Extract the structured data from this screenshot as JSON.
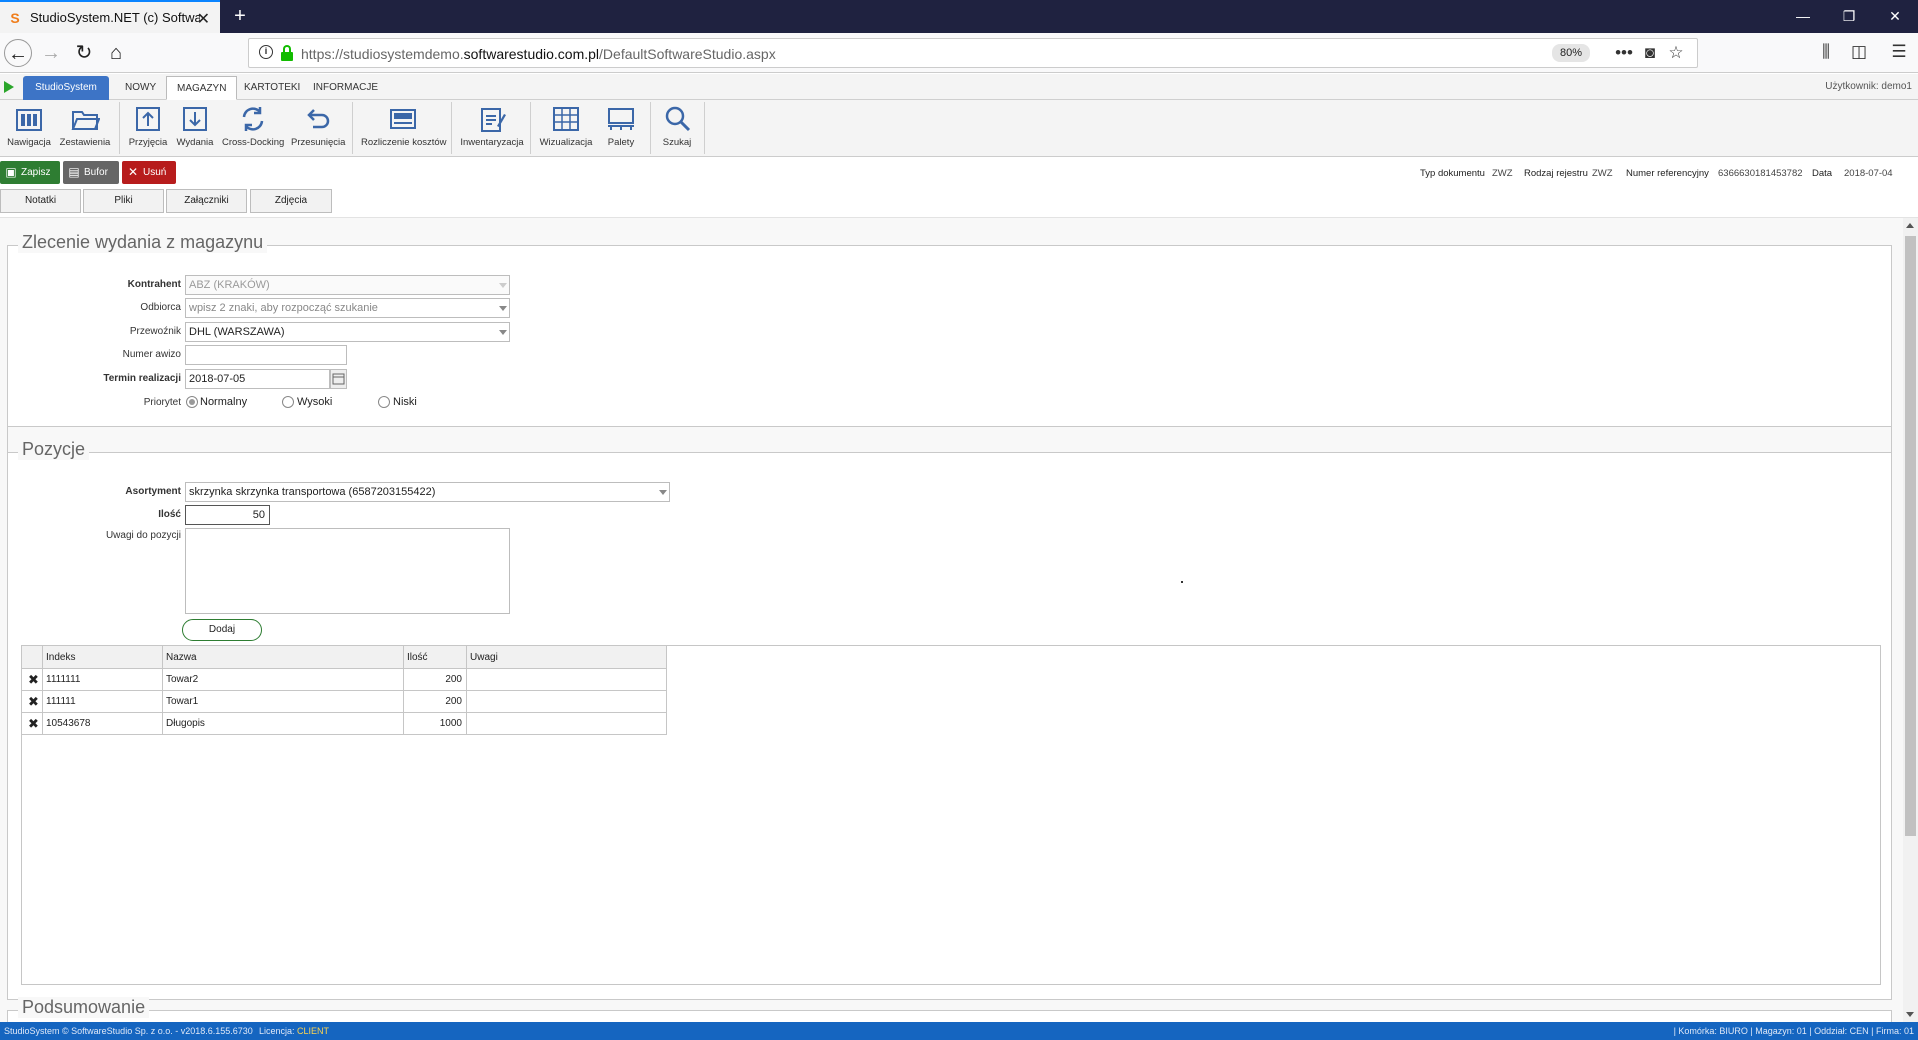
{
  "browser": {
    "tab_title": "StudioSystem.NET (c) Software",
    "url_prefix": "https://studiosystemdemo.",
    "url_domain": "softwarestudio.com.pl",
    "url_path": "/DefaultSoftwareStudio.aspx",
    "zoom": "80%"
  },
  "menu": {
    "brand": "StudioSystem",
    "tabs": [
      "NOWY",
      "MAGAZYN",
      "KARTOTEKI",
      "INFORMACJE"
    ],
    "active_tab": "MAGAZYN",
    "user": "Użytkownik: demo1"
  },
  "ribbon": [
    {
      "label": "Nawigacja",
      "icon": "navigation-icon"
    },
    {
      "label": "Zestawienia",
      "icon": "folder-open-icon"
    },
    {
      "label": "Przyjęcia",
      "icon": "receipt-upload-icon"
    },
    {
      "label": "Wydania",
      "icon": "release-download-icon"
    },
    {
      "label": "Cross-Docking",
      "icon": "cross-docking-icon"
    },
    {
      "label": "Przesunięcia",
      "icon": "undo-arrow-icon"
    },
    {
      "label": "Rozliczenie kosztów",
      "icon": "cost-settlement-icon"
    },
    {
      "label": "Inwentaryzacja",
      "icon": "inventory-clipboard-icon"
    },
    {
      "label": "Wizualizacja",
      "icon": "visualization-icon"
    },
    {
      "label": "Palety",
      "icon": "pallet-icon"
    },
    {
      "label": "Szukaj",
      "icon": "search-icon"
    }
  ],
  "actions": {
    "save": "Zapisz",
    "buffer": "Bufor",
    "delete": "Usuń"
  },
  "meta": {
    "doc_type_label": "Typ dokumentu",
    "doc_type_value": "ZWZ",
    "register_label": "Rodzaj rejestru",
    "register_value": "ZWZ",
    "ref_label": "Numer referencyjny",
    "ref_value": "6366630181453782",
    "date_label": "Data",
    "date_value": "2018-07-04"
  },
  "subtabs": [
    "Notatki",
    "Pliki",
    "Załączniki",
    "Zdjęcia"
  ],
  "order": {
    "legend": "Zlecenie wydania z magazynu",
    "kontrahent_label": "Kontrahent",
    "kontrahent_value": "ABZ (KRAKÓW)",
    "odbiorca_label": "Odbiorca",
    "odbiorca_placeholder": "wpisz 2 znaki, aby rozpocząć szukanie",
    "przewoznik_label": "Przewoźnik",
    "przewoznik_value": "DHL (WARSZAWA)",
    "awizo_label": "Numer awizo",
    "awizo_value": "",
    "termin_label": "Termin realizacji",
    "termin_value": "2018-07-05",
    "priorytet_label": "Priorytet",
    "priorities": [
      "Normalny",
      "Wysoki",
      "Niski"
    ],
    "priority_selected": "Normalny"
  },
  "positions": {
    "legend": "Pozycje",
    "asortyment_label": "Asortyment",
    "asortyment_value": "skrzynka skrzynka transportowa (6587203155422)",
    "ilosc_label": "Ilość",
    "ilosc_value": "50",
    "uwagi_label": "Uwagi do pozycji",
    "add_button": "Dodaj",
    "columns": [
      "Indeks",
      "Nazwa",
      "Ilość",
      "Uwagi"
    ],
    "rows": [
      {
        "indeks": "1111111",
        "nazwa": "Towar2",
        "ilosc": "200",
        "uwagi": ""
      },
      {
        "indeks": "111111",
        "nazwa": "Towar1",
        "ilosc": "200",
        "uwagi": ""
      },
      {
        "indeks": "10543678",
        "nazwa": "Długopis",
        "ilosc": "1000",
        "uwagi": ""
      }
    ]
  },
  "summary": {
    "legend": "Podsumowanie"
  },
  "footer": {
    "copyright": "StudioSystem © SoftwareStudio Sp. z o.o. - v2018.6.155.6730",
    "license_label": "Licencja:",
    "license_value": "CLIENT",
    "right": "| Komórka: BIURO | Magazyn: 01 | Oddział: CEN | Firma: 01"
  }
}
